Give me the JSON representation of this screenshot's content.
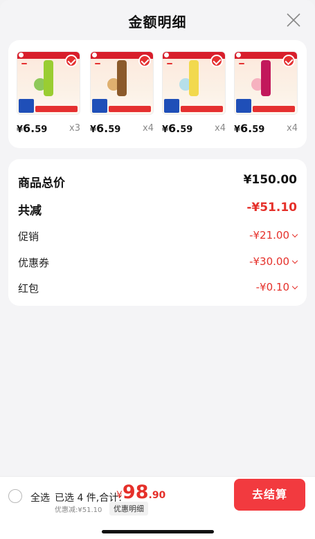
{
  "header": {
    "title": "金额明细"
  },
  "products": [
    {
      "price_symbol": "¥",
      "price_int": "6.",
      "price_dec": "59",
      "qty": "x3",
      "tube_color": "#9acd32",
      "deco_color": "#7ac142"
    },
    {
      "price_symbol": "¥",
      "price_int": "6.",
      "price_dec": "59",
      "qty": "x4",
      "tube_color": "#8b5a2b",
      "deco_color": "#d9a55b"
    },
    {
      "price_symbol": "¥",
      "price_int": "6.",
      "price_dec": "59",
      "qty": "x4",
      "tube_color": "#f2d94e",
      "deco_color": "#a9dcea"
    },
    {
      "price_symbol": "¥",
      "price_int": "6.",
      "price_dec": "59",
      "qty": "x4",
      "tube_color": "#c2185b",
      "deco_color": "#f4a6b8"
    }
  ],
  "summary": {
    "total_label": "商品总价",
    "total_value": "¥150.00",
    "cut_label": "共减",
    "cut_value": "-¥51.10",
    "promo_label": "促销",
    "promo_value": "-¥21.00",
    "coupon_label": "优惠券",
    "coupon_value": "-¥30.00",
    "redpacket_label": "红包",
    "redpacket_value": "-¥0.10"
  },
  "footer": {
    "select_all": "全选",
    "selected_text": "已选 4 件,合计:",
    "total_symbol": "¥",
    "total_int": "98",
    "total_dec": ".90",
    "discount_text": "优惠减:¥51.10",
    "detail_link": "优惠明细",
    "checkout": "去结算"
  },
  "colors": {
    "accent": "#f23a3f",
    "negative": "#e5302a"
  }
}
